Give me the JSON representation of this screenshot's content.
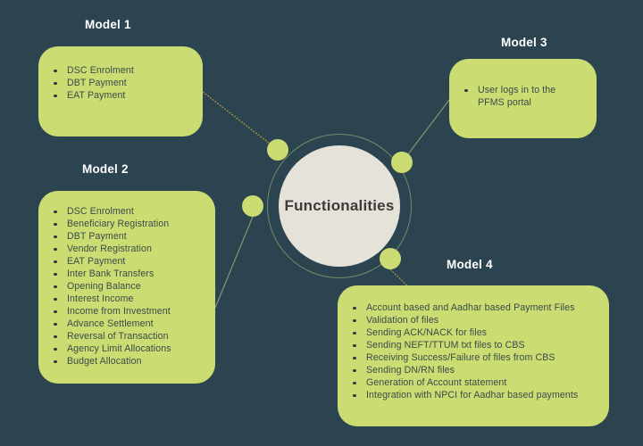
{
  "theme": {
    "background": "#2b4450",
    "accent_green": "#cbdd72",
    "center_fill": "#e5e2da",
    "title_color": "#ffffff",
    "body_text": "#3a4a4a",
    "connector_gold": "#b09a3a",
    "connector_green": "#7f9a6e"
  },
  "center": {
    "label": "Functionalities"
  },
  "models": [
    {
      "id": "model-1",
      "title": "Model 1",
      "items": [
        "DSC Enrolment",
        "DBT Payment",
        "EAT Payment"
      ]
    },
    {
      "id": "model-2",
      "title": "Model 2",
      "items": [
        "DSC Enrolment",
        "Beneficiary Registration",
        "DBT Payment",
        "Vendor Registration",
        "EAT Payment",
        "Inter Bank Transfers",
        "Opening Balance",
        "Interest Income",
        "Income from Investment",
        "Advance Settlement",
        "Reversal of Transaction",
        "Agency Limit Allocations",
        "Budget Allocation"
      ]
    },
    {
      "id": "model-3",
      "title": "Model 3",
      "items": [
        "User logs in to the PFMS portal"
      ]
    },
    {
      "id": "model-4",
      "title": "Model 4",
      "items": [
        "Account based and Aadhar based Payment Files",
        "Validation of files",
        "Sending ACK/NACK for files",
        "Sending NEFT/TTUM txt files to CBS",
        "Receiving Success/Failure of files from CBS",
        "Sending DN/RN files",
        "Generation of Account statement",
        "Integration with NPCI for Aadhar based payments"
      ]
    }
  ],
  "nodes": [
    {
      "id": "node-1",
      "name": "connector-node-model-1"
    },
    {
      "id": "node-2",
      "name": "connector-node-model-3"
    },
    {
      "id": "node-3",
      "name": "connector-node-model-2"
    },
    {
      "id": "node-4",
      "name": "connector-node-model-4"
    }
  ]
}
